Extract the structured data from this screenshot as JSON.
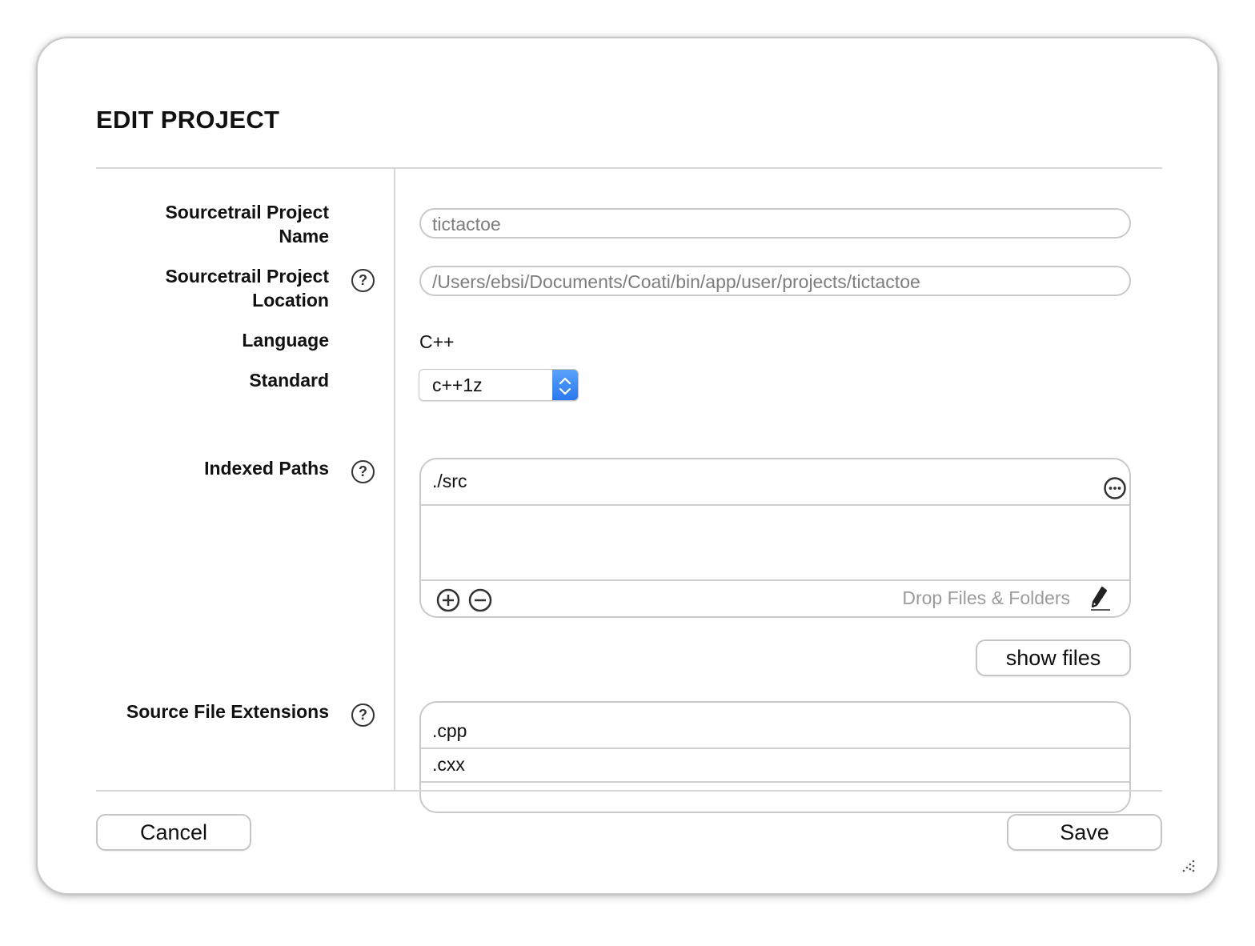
{
  "dialog": {
    "title": "EDIT PROJECT"
  },
  "fields": {
    "project_name_label_line1": "Sourcetrail Project",
    "project_name_label_line2": "Name",
    "project_name_value": "tictactoe",
    "project_location_label_line1": "Sourcetrail Project",
    "project_location_label_line2": "Location",
    "project_location_value": "/Users/ebsi/Documents/Coati/bin/app/user/projects/tictactoe",
    "language_label": "Language",
    "language_value": "C++",
    "standard_label": "Standard",
    "standard_value": "c++1z"
  },
  "indexed_paths": {
    "label": "Indexed Paths",
    "items": [
      "./src"
    ],
    "drop_hint": "Drop Files & Folders",
    "show_files_label": "show files"
  },
  "source_file_extensions": {
    "label": "Source File Extensions",
    "items": [
      ".cpp",
      ".cxx"
    ]
  },
  "footer": {
    "cancel_label": "Cancel",
    "save_label": "Save"
  },
  "icons": {
    "help": "question-circle-icon",
    "more": "ellipsis-circle-icon",
    "add": "plus-circle-icon",
    "remove": "minus-circle-icon",
    "edit": "pencil-icon",
    "stepper": "chevron-up-down-icon",
    "resize": "resize-grip-icon"
  },
  "colors": {
    "accent": "#2a78ef",
    "placeholder_text": "#7d7d7d",
    "border": "#c9c9c9"
  }
}
